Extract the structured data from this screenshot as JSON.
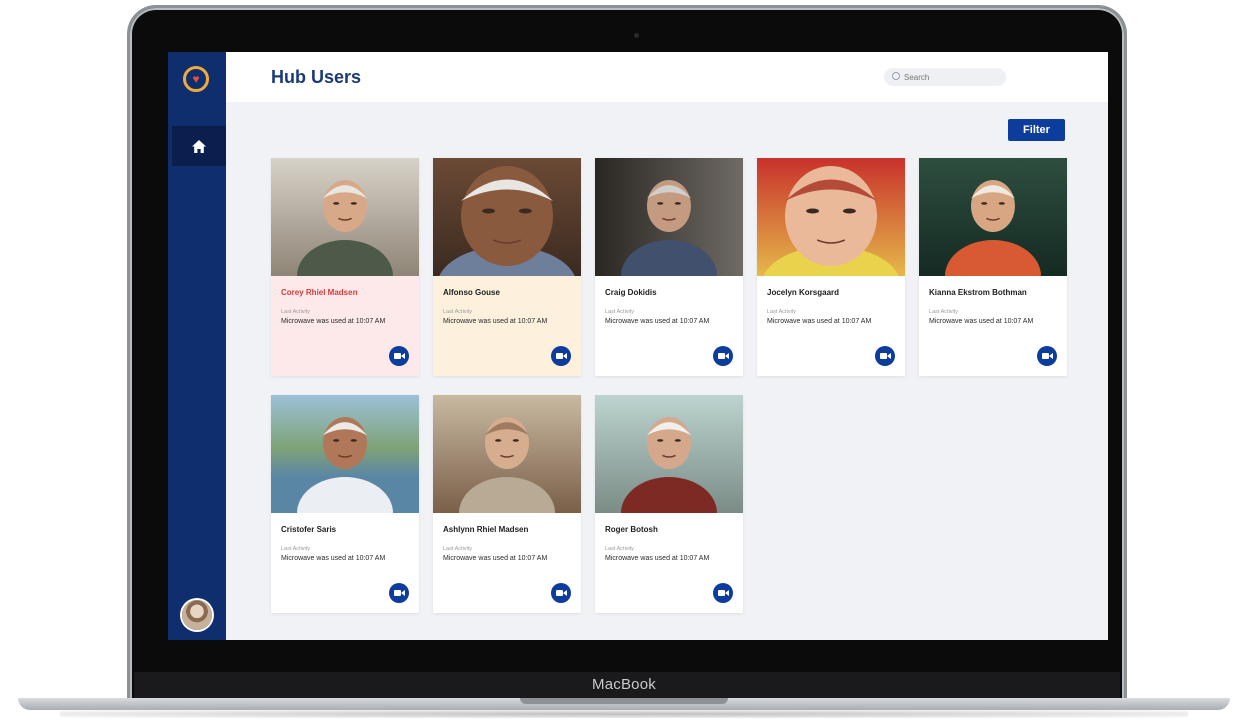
{
  "device": {
    "brand": "MacBook"
  },
  "app": {
    "page_title": "Hub Users",
    "search": {
      "placeholder": "Search"
    },
    "filter_label": "Filter"
  },
  "colors": {
    "sidebar": "#0f2e6e",
    "accent": "#0c3c9c",
    "title": "#1b3a7a",
    "alert_name": "#d63b3b",
    "card_alert_bg": "#fde9e9",
    "card_warn_bg": "#fdf0dd"
  },
  "sidebar": {
    "logo_icon": "heart-icon",
    "nav": [
      {
        "icon": "home-icon",
        "active": true
      }
    ],
    "avatar_icon": "user-avatar"
  },
  "users": [
    {
      "name": "Corey Rhiel Madsen",
      "status": "alert",
      "activity_label": "Last Activity",
      "activity": "Microwave was used at 10:07 AM",
      "action_icon": "video-icon"
    },
    {
      "name": "Alfonso Gouse",
      "status": "warning",
      "activity_label": "Last Activity",
      "activity": "Microwave was used at 10:07 AM",
      "action_icon": "video-icon"
    },
    {
      "name": "Craig Dokidis",
      "status": "normal",
      "activity_label": "Last Activity",
      "activity": "Microwave was used at 10:07 AM",
      "action_icon": "video-icon"
    },
    {
      "name": "Jocelyn Korsgaard",
      "status": "normal",
      "activity_label": "Last Activity",
      "activity": "Microwave was used at 10:07 AM",
      "action_icon": "video-icon"
    },
    {
      "name": "Kianna Ekstrom Bothman",
      "status": "normal",
      "activity_label": "Last Activity",
      "activity": "Microwave was used at 10:07 AM",
      "action_icon": "video-icon"
    },
    {
      "name": "Cristofer Saris",
      "status": "normal",
      "activity_label": "Last Activity",
      "activity": "Microwave was used at 10:07 AM",
      "action_icon": "video-icon"
    },
    {
      "name": "Ashlynn Rhiel Madsen",
      "status": "normal",
      "activity_label": "Last Activity",
      "activity": "Microwave was used at 10:07 AM",
      "action_icon": "video-icon"
    },
    {
      "name": "Roger Botosh",
      "status": "normal",
      "activity_label": "Last Activity",
      "activity": "Microwave was used at 10:07 AM",
      "action_icon": "video-icon"
    }
  ]
}
